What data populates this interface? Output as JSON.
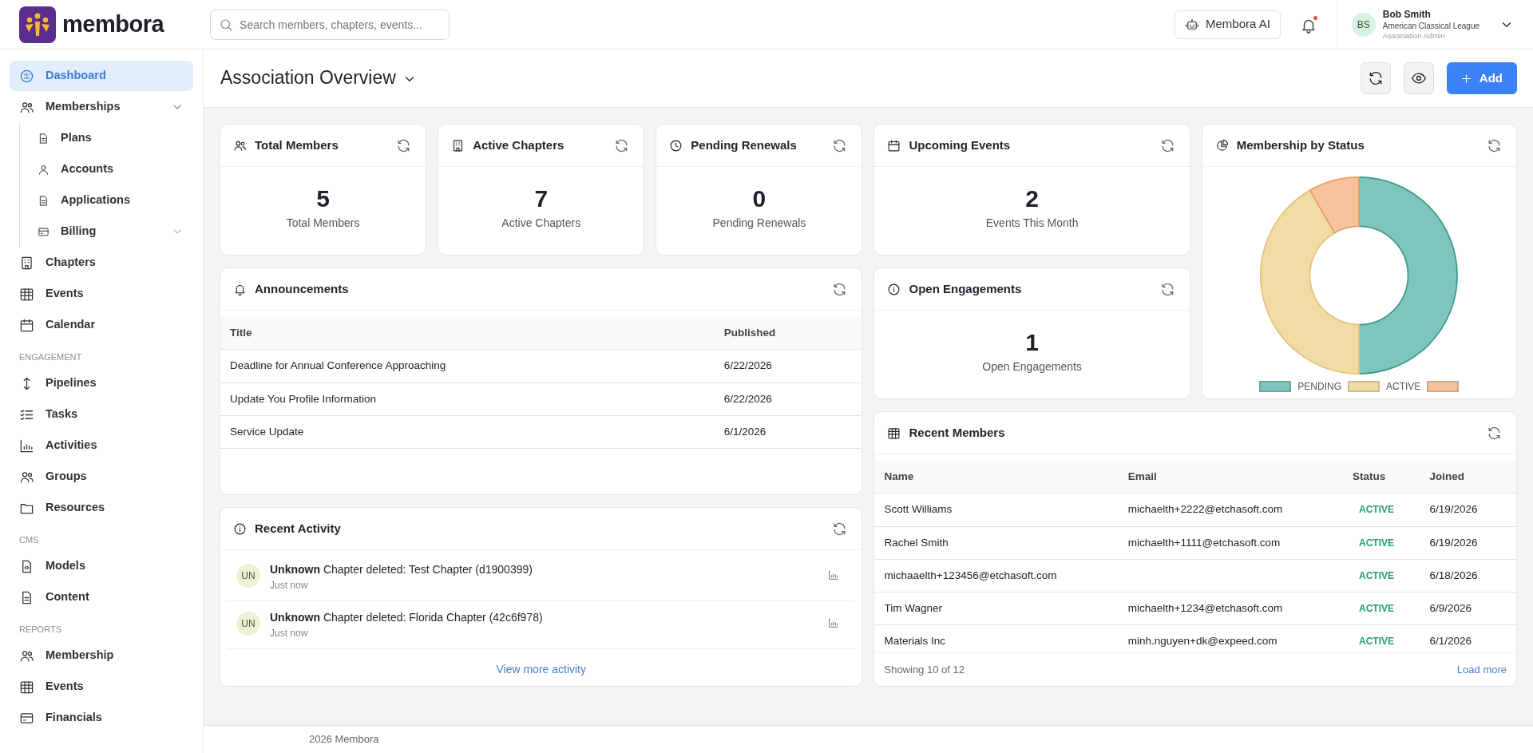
{
  "brand": {
    "name": "membora"
  },
  "search": {
    "placeholder": "Search members, chapters, events..."
  },
  "topbar": {
    "ai_button": "Membora AI",
    "notifications": {
      "unread": true
    },
    "user": {
      "initials": "BS",
      "name": "Bob Smith",
      "organization": "American Classical League",
      "role": "Association Admin"
    }
  },
  "sidebar": {
    "items": [
      {
        "kind": "link",
        "label": "Dashboard",
        "selected": true
      },
      {
        "kind": "link",
        "label": "Memberships",
        "selected": false,
        "expanded": true,
        "children": [
          {
            "kind": "link",
            "label": "Plans",
            "selected": false
          },
          {
            "kind": "link",
            "label": "Accounts",
            "selected": false
          },
          {
            "kind": "link",
            "label": "Applications",
            "selected": false
          },
          {
            "kind": "link",
            "label": "Billing",
            "selected": false,
            "expanded": false
          }
        ]
      },
      {
        "kind": "link",
        "label": "Chapters",
        "selected": false
      },
      {
        "kind": "link",
        "label": "Events",
        "selected": false
      },
      {
        "kind": "link",
        "label": "Calendar",
        "selected": false
      },
      {
        "kind": "section",
        "label": "ENGAGEMENT"
      },
      {
        "kind": "link",
        "label": "Pipelines",
        "selected": false
      },
      {
        "kind": "link",
        "label": "Tasks",
        "selected": false
      },
      {
        "kind": "link",
        "label": "Activities",
        "selected": false
      },
      {
        "kind": "link",
        "label": "Groups",
        "selected": false
      },
      {
        "kind": "link",
        "label": "Resources",
        "selected": false
      },
      {
        "kind": "section",
        "label": "CMS"
      },
      {
        "kind": "link",
        "label": "Models",
        "selected": false
      },
      {
        "kind": "link",
        "label": "Content",
        "selected": false
      },
      {
        "kind": "section",
        "label": "REPORTS"
      },
      {
        "kind": "link",
        "label": "Membership",
        "selected": false
      },
      {
        "kind": "link",
        "label": "Events",
        "selected": false
      },
      {
        "kind": "link",
        "label": "Financials",
        "selected": false
      }
    ]
  },
  "page_header": {
    "title": "Association Overview",
    "add_button": "Add"
  },
  "stats": [
    {
      "title": "Total Members",
      "value": "5",
      "caption": "Total Members"
    },
    {
      "title": "Active Chapters",
      "value": "7",
      "caption": "Active Chapters"
    },
    {
      "title": "Pending Renewals",
      "value": "0",
      "caption": "Pending Renewals"
    },
    {
      "title": "Upcoming Events",
      "value": "2",
      "caption": "Events This Month"
    }
  ],
  "membership_by_status": {
    "title": "Membership by Status",
    "legend": [
      {
        "label": "PENDING",
        "color": "#80c5bc"
      },
      {
        "label": "ACTIVE",
        "color": "#f2dca5"
      },
      {
        "color": "#f7c39c"
      }
    ]
  },
  "announcements": {
    "title": "Announcements",
    "columns": [
      "Title",
      "Published"
    ],
    "rows": [
      [
        "Deadline for Annual Conference Approaching",
        "6/22/2026"
      ],
      [
        "Update You Profile Information",
        "6/22/2026"
      ],
      [
        "Service Update",
        "6/1/2026"
      ]
    ]
  },
  "open_engagements": {
    "title": "Open Engagements",
    "value": "1",
    "caption": "Open Engagements"
  },
  "recent_members": {
    "title": "Recent Members",
    "columns": [
      "Name",
      "Email",
      "Status",
      "Joined"
    ],
    "rows": [
      {
        "name": "Scott Williams",
        "email": "michaelth+2222@etchasoft.com",
        "status": "ACTIVE",
        "joined": "6/19/2026"
      },
      {
        "name": "Rachel Smith",
        "email": "michaelth+1111@etchasoft.com",
        "status": "ACTIVE",
        "joined": "6/19/2026"
      },
      {
        "name": "michaaelth+123456@etchasoft.com",
        "status": "ACTIVE",
        "joined": "6/18/2026"
      },
      {
        "name": "Tim Wagner",
        "email": "michaelth+1234@etchasoft.com",
        "status": "ACTIVE",
        "joined": "6/9/2026"
      },
      {
        "name": "Materials Inc",
        "email": "minh.nguyen+dk@expeed.com",
        "status": "ACTIVE",
        "joined": "6/1/2026"
      }
    ],
    "summary": "Showing 10 of 12",
    "load_more": "Load more"
  },
  "recent_activity": {
    "title": "Recent Activity",
    "items": [
      {
        "initials": "UN",
        "text": "**Unknown** Chapter deleted: Test Chapter (d1900399)",
        "time": "Just now"
      },
      {
        "initials": "UN",
        "text": "**Unknown** Chapter deleted: Florida Chapter (42c6f978)",
        "time": "Just now"
      }
    ],
    "more_link": "View more activity"
  },
  "footer": {
    "text": "2026 Membora"
  }
}
